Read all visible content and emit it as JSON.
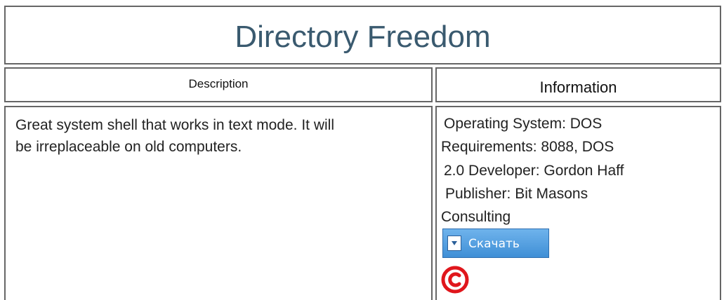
{
  "page": {
    "title": "Directory Freedom"
  },
  "headers": {
    "description": "Description",
    "information": "Information"
  },
  "description": {
    "text": "Great system shell that works in text mode. It will be irreplaceable on old computers."
  },
  "information": {
    "lines": [
      "Operating System: DOS",
      "Requirements: 8088, DOS",
      "2.0 Developer: Gordon Haff",
      "Publisher: Bit Masons",
      "Consulting"
    ],
    "download_label": "Скачать"
  },
  "colors": {
    "title": "#3a5a6f",
    "button": "#4a97dc",
    "copyright": "#e0161c"
  },
  "icons": {
    "download": "download-icon",
    "copyright": "copyright-icon"
  }
}
